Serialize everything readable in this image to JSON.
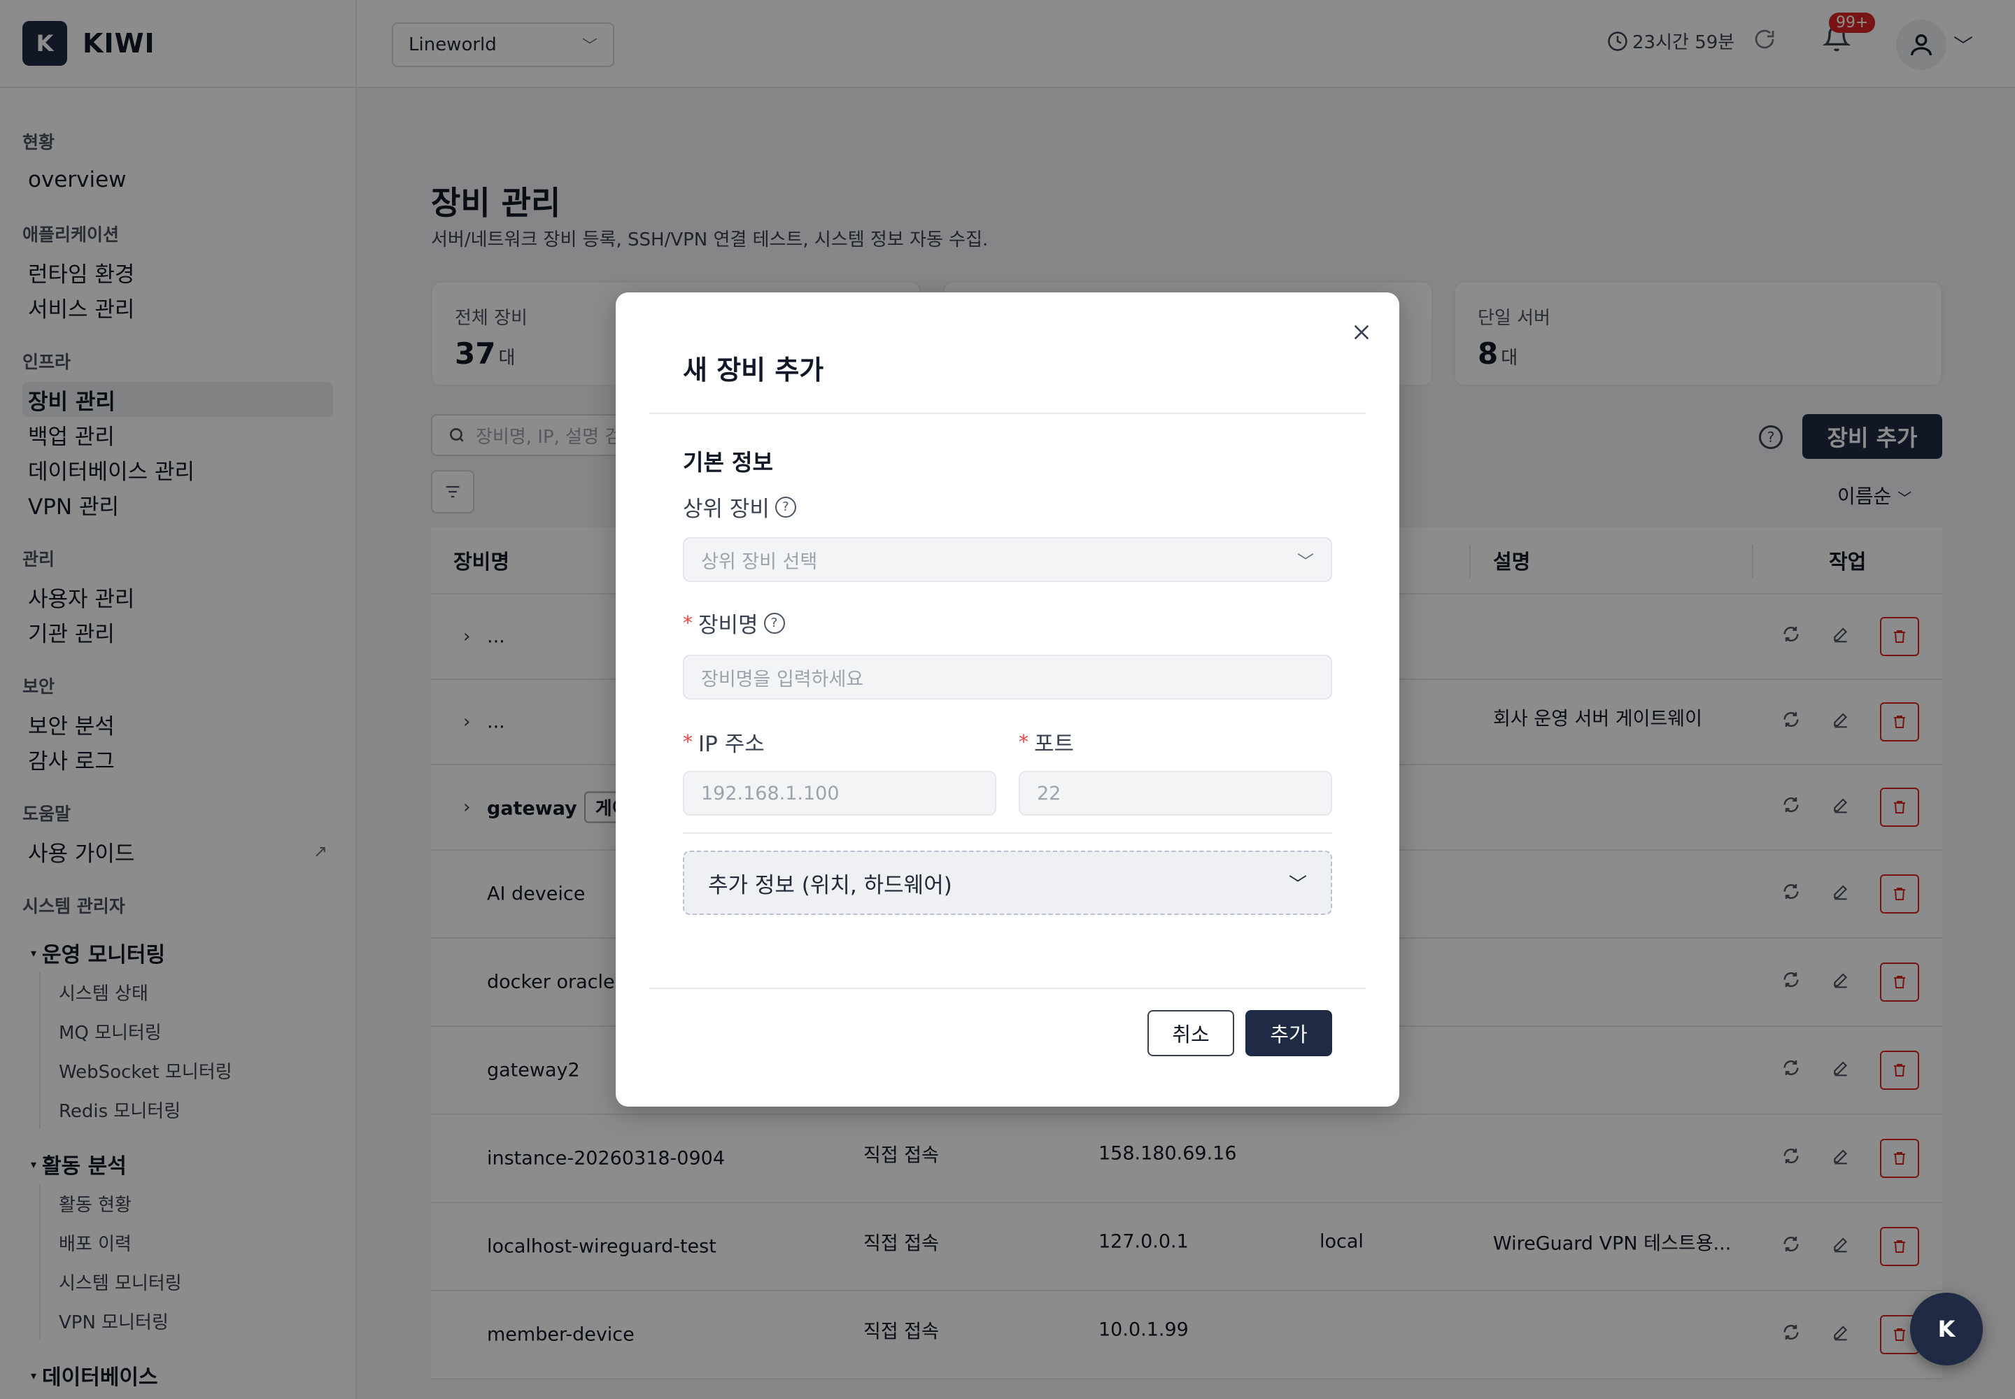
{
  "brand": {
    "logo_letter": "K",
    "name": "KIWI"
  },
  "sidebar": {
    "sections": [
      {
        "title": "현황",
        "items": [
          {
            "label": "overview"
          }
        ]
      },
      {
        "title": "애플리케이션",
        "items": [
          {
            "label": "런타임 환경"
          },
          {
            "label": "서비스 관리"
          }
        ]
      },
      {
        "title": "인프라",
        "items": [
          {
            "label": "장비 관리",
            "active": true
          },
          {
            "label": "백업 관리"
          },
          {
            "label": "데이터베이스 관리"
          },
          {
            "label": "VPN 관리"
          }
        ]
      },
      {
        "title": "관리",
        "items": [
          {
            "label": "사용자 관리"
          },
          {
            "label": "기관 관리"
          }
        ]
      },
      {
        "title": "보안",
        "items": [
          {
            "label": "보안 분석"
          },
          {
            "label": "감사 로그"
          }
        ]
      },
      {
        "title": "도움말",
        "items": [
          {
            "label": "사용 가이드",
            "external_mark": "↗"
          }
        ]
      }
    ],
    "admin_title": "시스템 관리자",
    "groups": [
      {
        "label": "운영 모니터링",
        "items": [
          "시스템 상태",
          "MQ 모니터링",
          "WebSocket 모니터링",
          "Redis 모니터링"
        ]
      },
      {
        "label": "활동 분석",
        "items": [
          "활동 현황",
          "배포 이력",
          "시스템 모니터링",
          "VPN 모니터링"
        ]
      },
      {
        "label": "데이터베이스",
        "items": []
      }
    ]
  },
  "topbar": {
    "org_select": "Lineworld",
    "session_time": "23시간 59분",
    "notification_badge": "99+"
  },
  "page": {
    "title": "장비 관리",
    "description": "서버/네트워크 장비 등록, SSH/VPN 연결 테스트, 시스템 정보 자동 수집.",
    "stats": [
      {
        "label": "전체 장비",
        "value": "37",
        "unit": "대"
      },
      {
        "label": "단일 서버",
        "value": "8",
        "unit": "대"
      }
    ],
    "search_placeholder": "장비명, IP, 설명 검",
    "add_button": "장비 추가",
    "sort_label": "이름순"
  },
  "table": {
    "headers": {
      "name": "장비명",
      "description": "설명",
      "actions": "작업"
    },
    "rows": [
      {
        "name": "...",
        "expandable": true,
        "conn": "",
        "ip": "",
        "loc": "",
        "desc": ""
      },
      {
        "name": "...",
        "expandable": true,
        "conn": "",
        "ip": "",
        "loc": "",
        "desc": "회사 운영 서버 게이트웨이"
      },
      {
        "name": "gateway",
        "expandable": true,
        "tag": "게이",
        "conn": "",
        "ip": "",
        "loc": "",
        "desc": ""
      },
      {
        "name": "AI deveice",
        "conn": "",
        "ip": "",
        "loc": "",
        "desc": ""
      },
      {
        "name": "docker oracle",
        "conn": "",
        "ip": "",
        "loc": "",
        "desc": ""
      },
      {
        "name": "gateway2",
        "conn": "",
        "ip": "",
        "loc": "",
        "desc": ""
      },
      {
        "name": "instance-20260318-0904",
        "conn": "직접 접속",
        "ip": "158.180.69.16",
        "loc": "",
        "desc": ""
      },
      {
        "name": "localhost-wireguard-test",
        "conn": "직접 접속",
        "ip": "127.0.0.1",
        "loc": "local",
        "desc": "WireGuard VPN 테스트용..."
      },
      {
        "name": "member-device",
        "conn": "직접 접속",
        "ip": "10.0.1.99",
        "loc": "",
        "desc": ""
      }
    ]
  },
  "modal": {
    "title": "새 장비 추가",
    "section_title": "기본 정보",
    "parent_label": "상위 장비",
    "parent_placeholder": "상위 장비 선택",
    "name_label": "장비명",
    "name_placeholder": "장비명을 입력하세요",
    "ip_label": "IP 주소",
    "ip_placeholder": "192.168.1.100",
    "port_label": "포트",
    "port_placeholder": "22",
    "required_mark": "*",
    "extra_info_label": "추가 정보 (위치, 하드웨어)",
    "cancel_label": "취소",
    "submit_label": "추가"
  },
  "fab": {
    "label": "K"
  },
  "colors": {
    "primary": "#1f2a44",
    "danger": "#dc2626",
    "overlay": "rgba(0,0,0,0.45)"
  },
  "icons": {
    "clock": "clock-icon",
    "refresh": "refresh-icon",
    "bell": "bell-icon",
    "user": "user-icon",
    "search": "search-icon",
    "filter": "filter-icon",
    "help": "help-icon",
    "close": "close-icon",
    "edit": "edit-icon",
    "delete": "trash-icon",
    "sync": "sync-icon"
  }
}
